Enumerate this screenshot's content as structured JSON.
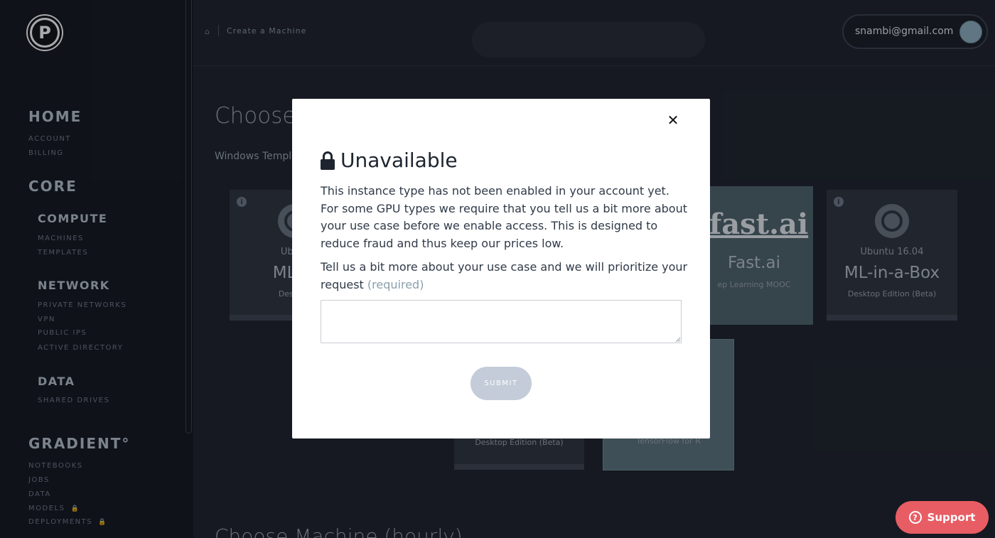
{
  "logo": {
    "letter": "P"
  },
  "sidebar": {
    "home": {
      "title": "HOME",
      "links": [
        "ACCOUNT",
        "BILLING"
      ]
    },
    "core": {
      "title": "CORE",
      "compute": {
        "title": "COMPUTE",
        "links": [
          "MACHINES",
          "TEMPLATES"
        ]
      },
      "network": {
        "title": "NETWORK",
        "links": [
          "PRIVATE NETWORKS",
          "VPN",
          "PUBLIC IPS",
          "ACTIVE DIRECTORY"
        ]
      },
      "data": {
        "title": "DATA",
        "links": [
          "SHARED DRIVES"
        ]
      }
    },
    "gradient": {
      "title": "GRADIENT°",
      "links": [
        "NOTEBOOKS",
        "JOBS",
        "DATA",
        "MODELS",
        "DEPLOYMENTS"
      ]
    }
  },
  "header": {
    "breadcrumb": "Create a Machine",
    "user_email": "snambi@gmail.com"
  },
  "main": {
    "heading": "Choose",
    "tab": "Windows Templa",
    "cards": [
      {
        "line1": "Ubunt",
        "line2": "ML-in",
        "line3": "Desktop"
      },
      {
        "brand": "fast.ai",
        "line2": "Fast.ai",
        "line3": "ep Learning MOOC"
      },
      {
        "line1": "Ubuntu 16.04",
        "line2": "ML-in-a-Box",
        "line3": "Desktop Edition (Beta)"
      },
      {
        "line3": "Desktop Edition (Beta)"
      },
      {
        "line3": "TensorFlow for R"
      }
    ],
    "bottom_heading": "Choose Machine (hourly)"
  },
  "modal": {
    "title": "Unavailable",
    "description": "This instance type has not been enabled in your account yet. For some GPU types we require that you tell us a bit more about your use case before we enable access. This is designed to reduce fraud and thus keep our prices low.",
    "prompt": "Tell us a bit more about your use case and we will prioritize your request",
    "required_label": "(required)",
    "input_value": "",
    "submit_label": "SUBMIT"
  },
  "support": {
    "label": "Support"
  },
  "colors": {
    "accent": "#e85d64",
    "sidebar_bg": "#141820",
    "modal_bg": "#ffffff",
    "submit_disabled": "#c3ccd8"
  }
}
